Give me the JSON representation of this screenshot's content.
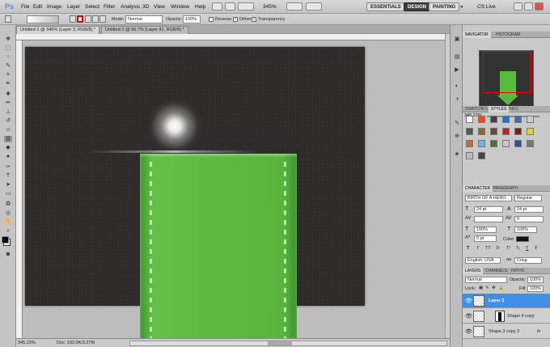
{
  "app": {
    "logo": "Ps"
  },
  "menu": [
    "File",
    "Edit",
    "Image",
    "Layer",
    "Select",
    "Filter",
    "Analysis",
    "3D",
    "View",
    "Window",
    "Help"
  ],
  "header": {
    "zoom": "345%",
    "workspaces": [
      "ESSENTIALS",
      "DESIGN",
      "PAINTING"
    ],
    "cslive": "CS Live"
  },
  "options": {
    "mode_label": "Mode:",
    "mode_value": "Normal",
    "opacity_label": "Opacity:",
    "opacity_value": "100%",
    "reverse": "Reverse",
    "dither": "Dither",
    "transparency": "Transparency"
  },
  "tabs": [
    "Untitled-1 @ 345% (Layer 3, RGB/8) *",
    "Untitled-2 @ 66.7% (Layer 41, RGB/8) *"
  ],
  "status": {
    "zoom": "345.23%",
    "doc": "Doc: 192.0K/3.27M"
  },
  "navigator": {
    "tabs": [
      "NAVIGATOR",
      "HISTOGRAM"
    ],
    "zoom": "345.23%"
  },
  "swatches": {
    "tabs": [
      "SWATCHES",
      "STYLES",
      "INFO"
    ]
  },
  "character": {
    "tabs": [
      "CHARACTER",
      "PARAGRAPH"
    ],
    "font": "BIRTH OF A HERO",
    "style": "Regular",
    "size": "24 pt",
    "leading": "24 pt",
    "tracking": "0",
    "vscale": "100%",
    "hscale": "100%",
    "baseline": "0 pt",
    "color_label": "Color:",
    "language": "English: USA",
    "aa": "Crisp",
    "glyphs": [
      "T",
      "T",
      "TT",
      "Tr",
      "T¹",
      "T₁",
      "T",
      "Ŧ"
    ]
  },
  "layers": {
    "tabs": [
      "LAYERS",
      "CHANNELS",
      "PATHS"
    ],
    "blend": "Normal",
    "opacity_label": "Opacity:",
    "opacity": "100%",
    "lock_label": "Lock:",
    "fill_label": "Fill:",
    "fill": "100%",
    "items": [
      {
        "name": "Layer 3"
      },
      {
        "name": "Shape 4 copy"
      },
      {
        "name": "Shape 3 copy 3"
      }
    ]
  },
  "colors": {
    "accent": "#3d8fe8",
    "ribbon": "#5cb940",
    "bg": "#2d2b2a"
  }
}
